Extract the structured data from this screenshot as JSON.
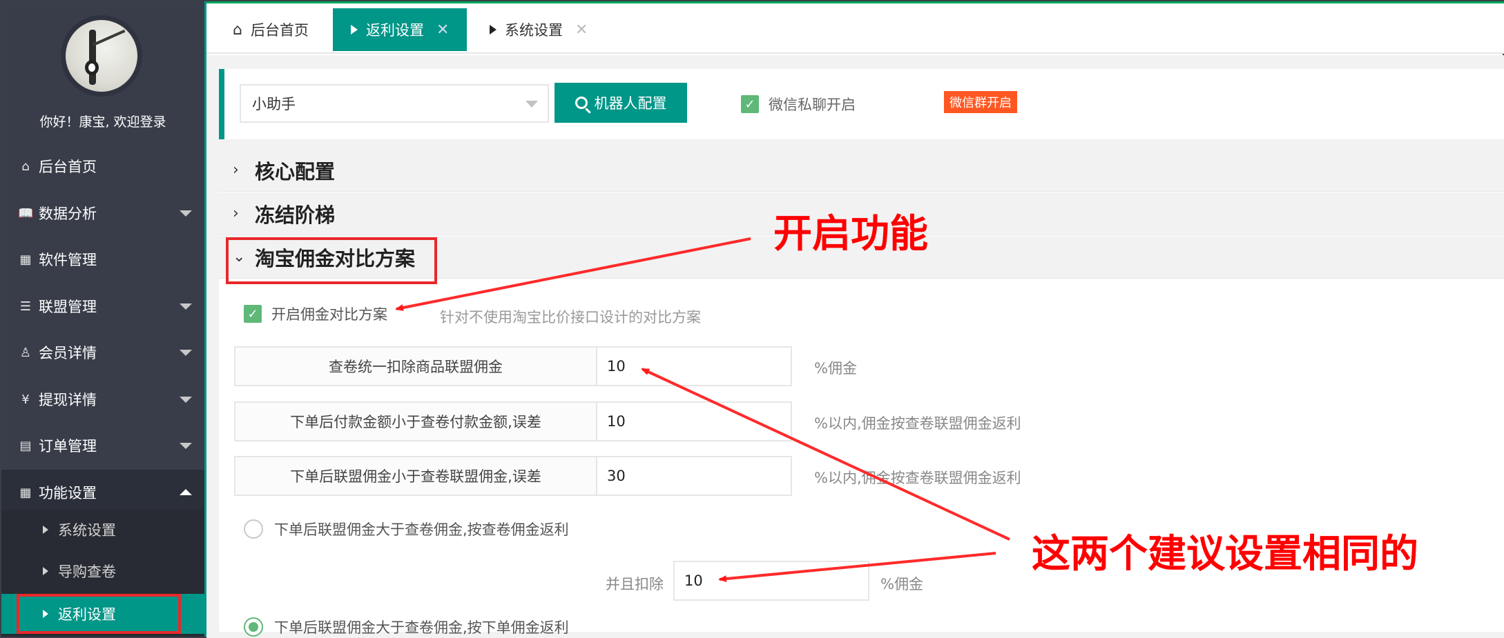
{
  "sidebar": {
    "greeting": "你好！康宝, 欢迎登录",
    "items": [
      {
        "label": "后台首页",
        "icon": "home-icon",
        "glyph": "⌂",
        "caret": false
      },
      {
        "label": "数据分析",
        "icon": "book-icon",
        "glyph": "📖",
        "caret": true
      },
      {
        "label": "软件管理",
        "icon": "grid-icon",
        "glyph": "▦",
        "caret": false
      },
      {
        "label": "联盟管理",
        "icon": "list-icon",
        "glyph": "☰",
        "caret": true
      },
      {
        "label": "会员详情",
        "icon": "user-icon",
        "glyph": "♙",
        "caret": true
      },
      {
        "label": "提现详情",
        "icon": "yen-icon",
        "glyph": "¥",
        "caret": true
      },
      {
        "label": "订单管理",
        "icon": "table-icon",
        "glyph": "▤",
        "caret": true
      },
      {
        "label": "功能设置",
        "icon": "apps-icon",
        "glyph": "▦",
        "caret": true
      }
    ],
    "subitems": [
      {
        "label": "系统设置"
      },
      {
        "label": "导购查卷"
      },
      {
        "label": "返利设置"
      }
    ]
  },
  "tabs": {
    "home": "后台首页",
    "rebate": "返利设置",
    "system": "系统设置",
    "close_glyph": "✕",
    "home_glyph": "⌂"
  },
  "toolbar": {
    "robot_select_value": "小助手",
    "robot_button_label": "机器人配置",
    "wx_private_label": "微信私聊开启",
    "wx_private_checked": true,
    "wx_group_badge": "微信群开启"
  },
  "panel": {
    "sections": [
      {
        "title": "核心配置",
        "expanded": false
      },
      {
        "title": "冻结阶梯",
        "expanded": false
      },
      {
        "title": "淘宝佣金对比方案",
        "expanded": true
      }
    ],
    "chev_collapsed": "›",
    "chev_expanded": "⌄",
    "enable_label": "开启佣金对比方案",
    "enable_checked": true,
    "enable_hint": "针对不使用淘宝比价接口设计的对比方案",
    "check_glyph": "✓",
    "rows": [
      {
        "label": "查卷统一扣除商品联盟佣金",
        "value": "10",
        "aux": "%佣金"
      },
      {
        "label": "下单后付款金额小于查卷付款金额,误差",
        "value": "10",
        "aux": "%以内,佣金按查卷联盟佣金返利"
      },
      {
        "label": "下单后联盟佣金小于查卷联盟佣金,误差",
        "value": "30",
        "aux": "%以内,佣金按查卷联盟佣金返利"
      }
    ],
    "radios": [
      {
        "label": "下单后联盟佣金大于查卷佣金,按查卷佣金返利",
        "selected": false
      },
      {
        "label": "下单后联盟佣金大于查卷佣金,按下单佣金返利",
        "selected": true
      }
    ],
    "deduct_label": "并且扣除",
    "deduct_value": "10",
    "deduct_unit": "%佣金"
  },
  "annotations": {
    "enable_feature": "开启功能",
    "same_suggestion": "这两个建议设置相同的",
    "color": "#ff0000"
  },
  "colors": {
    "accent": "#009688",
    "sidebar_bg": "#393d49",
    "checkbox": "#5fb878",
    "badge": "#ff5722",
    "highlight_box": "#e8282b"
  }
}
